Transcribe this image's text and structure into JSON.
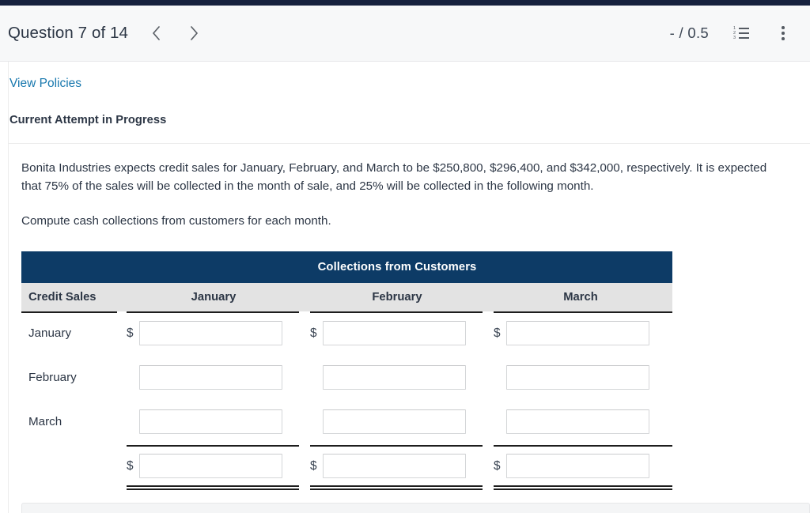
{
  "theme": {
    "top_strip": "#16213e",
    "table_banner": "#0d3b66",
    "subheader_bg": "#e3e3e3",
    "link_color": "#1878ae",
    "text_color": "#2c3645"
  },
  "header": {
    "question_title": "Question 7 of 14",
    "prev_label": "Previous question",
    "next_label": "Next question",
    "score": "- / 0.5",
    "list_icon": "numbered-list-icon",
    "menu_icon": "kebab-menu-icon",
    "list_numbers": [
      "1",
      "2",
      "3"
    ]
  },
  "links": {
    "view_policies": "View Policies"
  },
  "attempt": {
    "status_title": "Current Attempt in Progress"
  },
  "question": {
    "paragraph_1": "Bonita Industries expects credit sales for January, February, and March to be $250,800, $296,400, and $342,000, respectively. It is expected that 75% of the sales will be collected in the month of sale, and 25% will be collected in the following month.",
    "paragraph_2": "Compute cash collections from customers for each month."
  },
  "table": {
    "banner": "Collections from Customers",
    "columns": [
      "Credit Sales",
      "January",
      "February",
      "March"
    ],
    "rows": [
      {
        "label": "January",
        "show_dollar": true,
        "values": [
          "",
          "",
          ""
        ],
        "placeholders": [
          "",
          "",
          ""
        ]
      },
      {
        "label": "February",
        "show_dollar": false,
        "values": [
          "",
          "",
          ""
        ],
        "placeholders": [
          "",
          "",
          ""
        ]
      },
      {
        "label": "March",
        "show_dollar": false,
        "values": [
          "",
          "",
          ""
        ],
        "placeholders": [
          "",
          "",
          ""
        ]
      }
    ],
    "total_row": {
      "label": "",
      "show_dollar": true,
      "values": [
        "",
        "",
        ""
      ],
      "placeholders": [
        "",
        "",
        ""
      ]
    }
  }
}
